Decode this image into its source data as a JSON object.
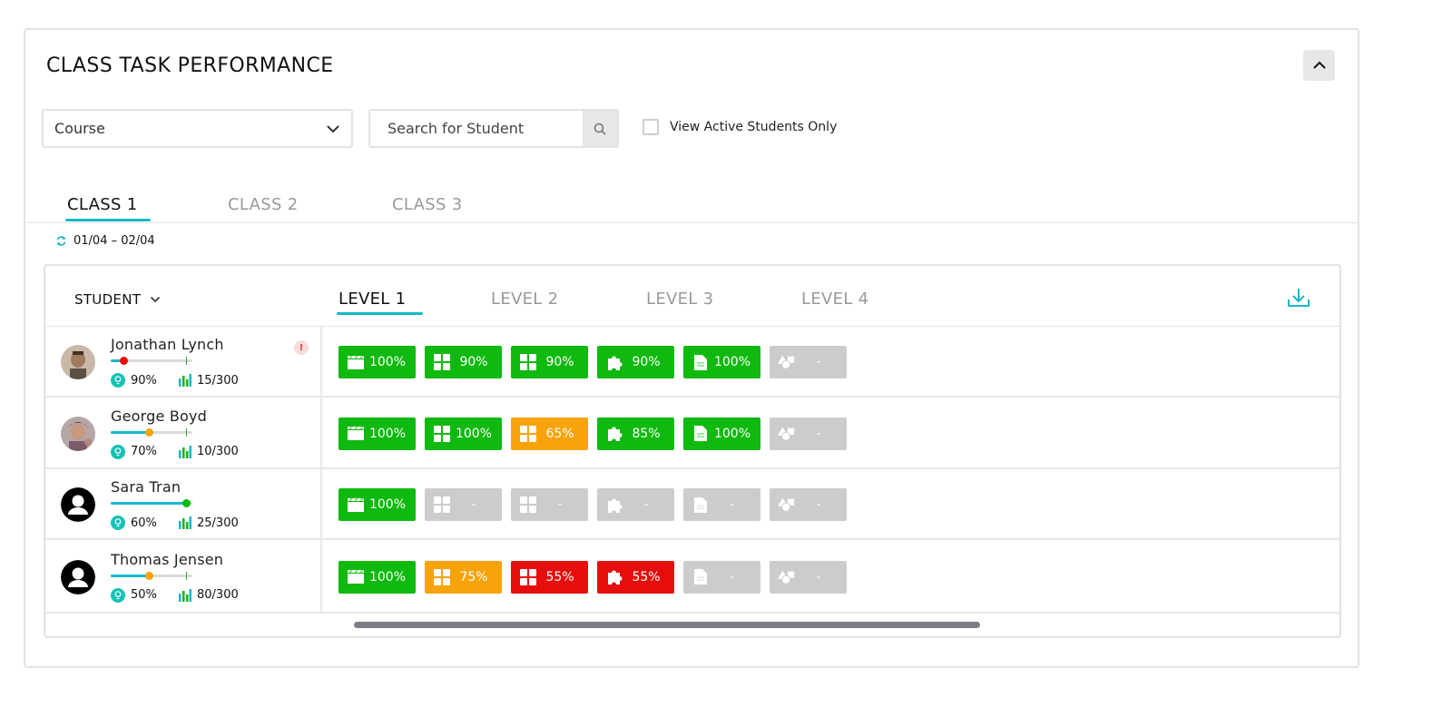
{
  "title": "CLASS TASK PERFORMANCE",
  "filters": {
    "course_label": "Course",
    "search_placeholder": "Search for Student",
    "active_only_label": "View Active Students Only"
  },
  "class_tabs": [
    "CLASS 1",
    "CLASS 2",
    "CLASS 3"
  ],
  "active_class_tab": 0,
  "date_range": "01/04 – 02/04",
  "student_column_label": "STUDENT",
  "level_tabs": [
    "LEVEL 1",
    "LEVEL 2",
    "LEVEL 3",
    "LEVEL 4"
  ],
  "active_level_tab": 0,
  "colors": {
    "accent": "#17b8c9",
    "good": "#10b90f",
    "warning": "#f8a30a",
    "bad": "#e60d0d",
    "na": "#cccccc"
  },
  "task_icons": [
    "clapperboard-icon",
    "grid-icon",
    "grid-icon",
    "puzzle-icon",
    "document-icon",
    "shapes-icon"
  ],
  "students": [
    {
      "name": "Jonathan Lynch",
      "avatar": "photo",
      "alert": "!",
      "progress": 0.15,
      "progress_color": "#e60d0d",
      "score": "90%",
      "points": "15/300",
      "tasks": [
        {
          "value": "100%",
          "status": "good"
        },
        {
          "value": "90%",
          "status": "good"
        },
        {
          "value": "90%",
          "status": "good"
        },
        {
          "value": "90%",
          "status": "good"
        },
        {
          "value": "100%",
          "status": "good"
        },
        {
          "value": "-",
          "status": "na"
        }
      ]
    },
    {
      "name": "George Boyd",
      "avatar": "photo",
      "alert": "",
      "progress": 0.47,
      "progress_color": "#f8a30a",
      "score": "70%",
      "points": "10/300",
      "tasks": [
        {
          "value": "100%",
          "status": "good"
        },
        {
          "value": "100%",
          "status": "good"
        },
        {
          "value": "65%",
          "status": "warning"
        },
        {
          "value": "85%",
          "status": "good"
        },
        {
          "value": "100%",
          "status": "good"
        },
        {
          "value": "-",
          "status": "na"
        }
      ]
    },
    {
      "name": "Sara Tran",
      "avatar": "default",
      "alert": "",
      "progress": 0.92,
      "progress_color": "#10b90f",
      "score": "60%",
      "points": "25/300",
      "tasks": [
        {
          "value": "100%",
          "status": "good"
        },
        {
          "value": "-",
          "status": "na"
        },
        {
          "value": "-",
          "status": "na"
        },
        {
          "value": "-",
          "status": "na"
        },
        {
          "value": "-",
          "status": "na"
        },
        {
          "value": "-",
          "status": "na"
        }
      ]
    },
    {
      "name": "Thomas Jensen",
      "avatar": "default",
      "alert": "",
      "progress": 0.47,
      "progress_color": "#f8a30a",
      "score": "50%",
      "points": "80/300",
      "tasks": [
        {
          "value": "100%",
          "status": "good"
        },
        {
          "value": "75%",
          "status": "warning"
        },
        {
          "value": "55%",
          "status": "bad"
        },
        {
          "value": "55%",
          "status": "bad"
        },
        {
          "value": "-",
          "status": "na"
        },
        {
          "value": "-",
          "status": "na"
        }
      ]
    }
  ]
}
